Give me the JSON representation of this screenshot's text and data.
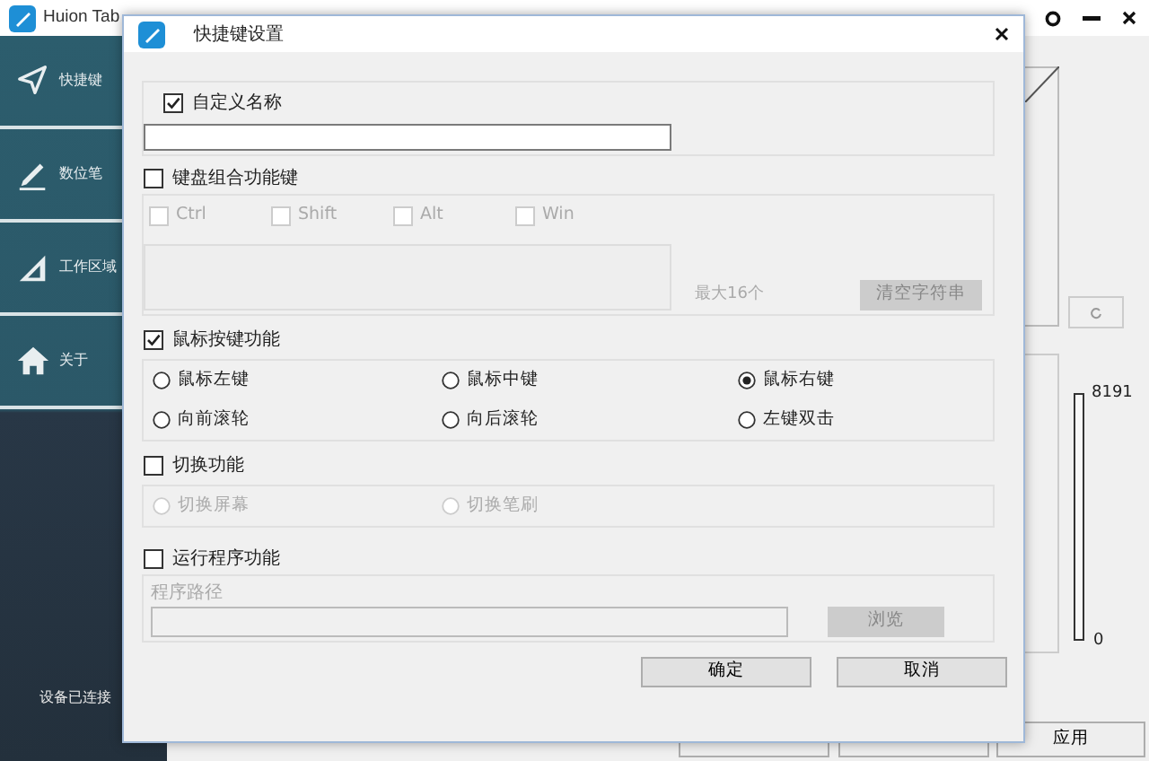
{
  "app": {
    "title": "Huion Tab",
    "sidebar": [
      {
        "label": "快捷键"
      },
      {
        "label": "数位笔"
      },
      {
        "label": "工作区域"
      },
      {
        "label": "关于"
      }
    ],
    "status": "设备已连接",
    "pressure": {
      "max": "8191",
      "min": "0"
    },
    "apply_button": "应用"
  },
  "dialog": {
    "title": "快捷键设置",
    "sections": [
      {
        "kind": "name",
        "label": "自定义名称",
        "checked": true
      },
      {
        "kind": "keys",
        "label": "键盘组合功能键",
        "checked": false,
        "keys": [
          {
            "label": "Ctrl",
            "checked": false
          },
          {
            "label": "Shift",
            "checked": false
          },
          {
            "label": "Alt",
            "checked": false
          },
          {
            "label": "Win",
            "checked": false
          }
        ],
        "limit": "最大16个",
        "clear_button": "清空字符串"
      },
      {
        "kind": "radios",
        "label": "鼠标按键功能",
        "checked": true,
        "options": [
          {
            "label": "鼠标左键",
            "selected": false
          },
          {
            "label": "鼠标中键",
            "selected": false
          },
          {
            "label": "鼠标右键",
            "selected": true
          },
          {
            "label": "向前滚轮",
            "selected": false
          },
          {
            "label": "向后滚轮",
            "selected": false
          },
          {
            "label": "左键双击",
            "selected": false
          }
        ]
      },
      {
        "kind": "radios",
        "label": "切换功能",
        "checked": false,
        "options": [
          {
            "label": "切换屏幕",
            "selected": false
          },
          {
            "label": "切换笔刷",
            "selected": false
          }
        ]
      },
      {
        "kind": "program",
        "label": "运行程序功能",
        "checked": false,
        "path_label": "程序路径",
        "browse_button": "浏览"
      }
    ],
    "buttons": [
      "确定",
      "取消"
    ]
  }
}
